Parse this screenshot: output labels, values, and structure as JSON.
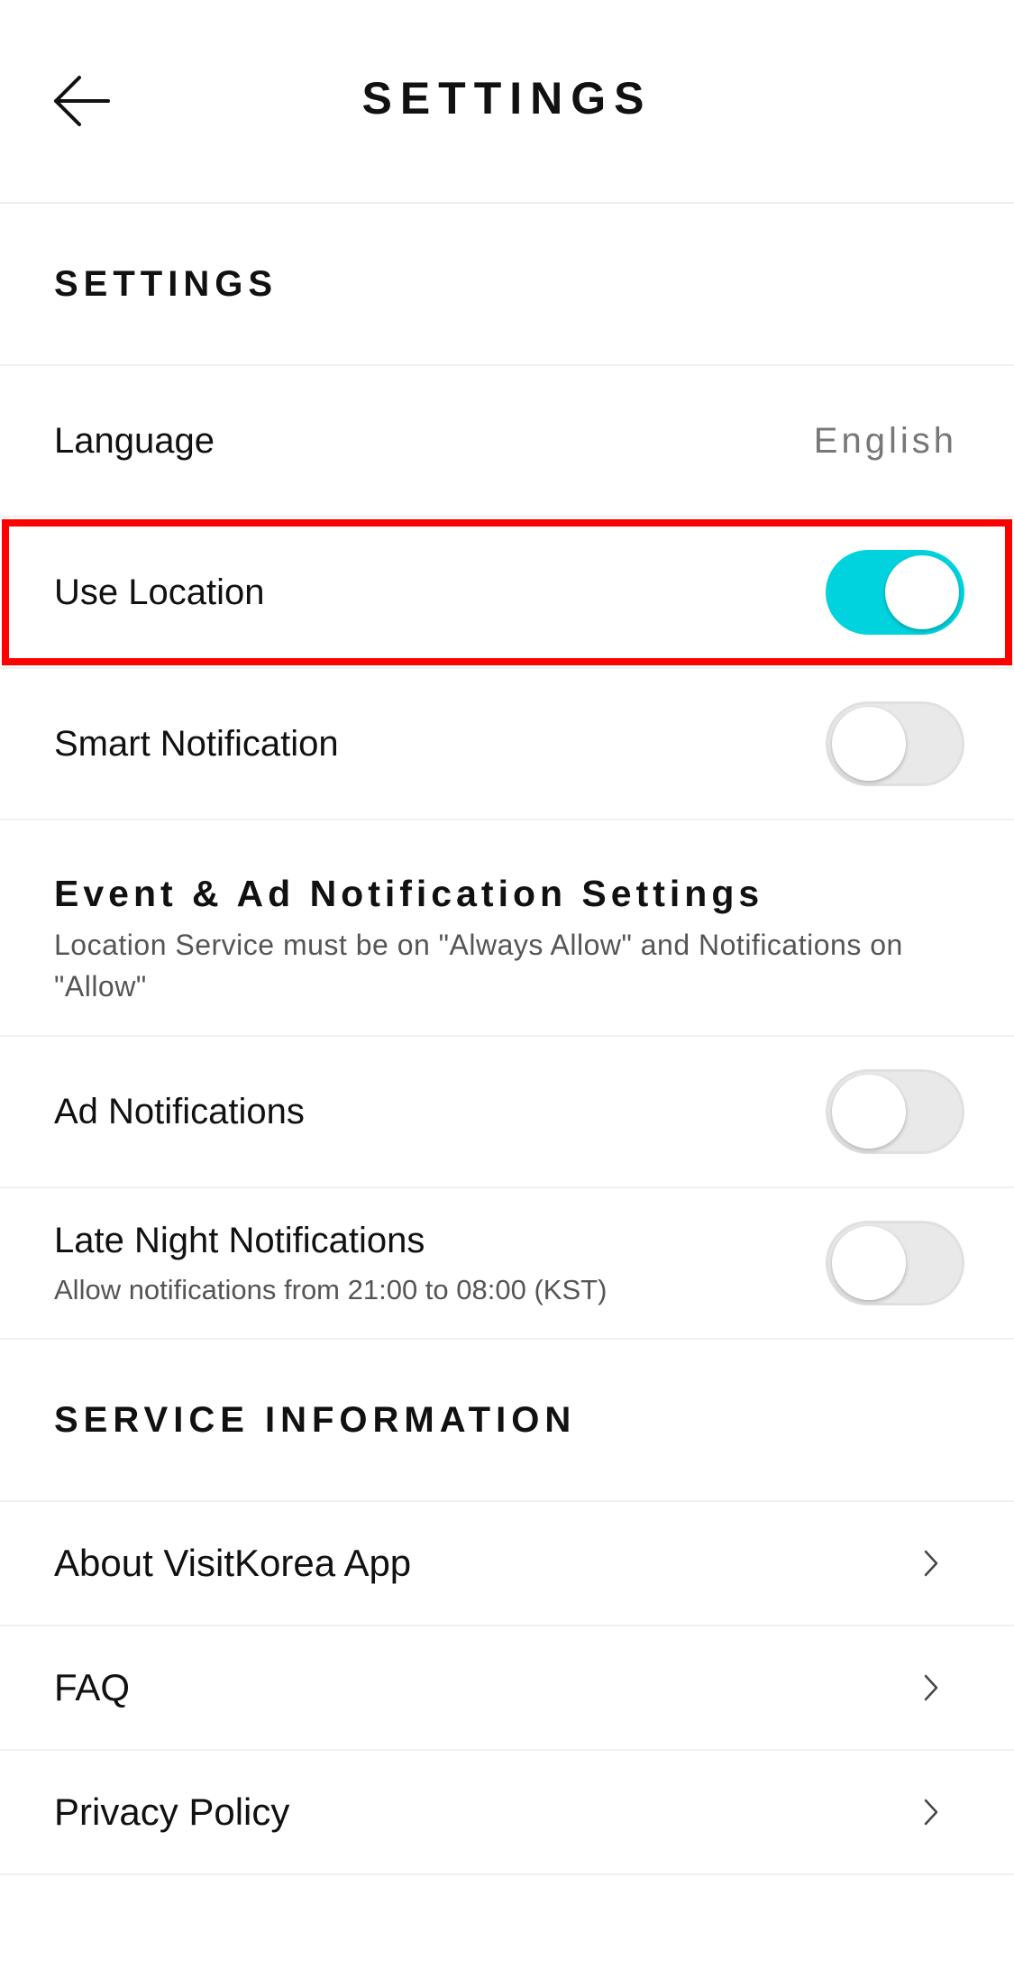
{
  "header": {
    "title": "SETTINGS"
  },
  "settings_section": {
    "title": "SETTINGS",
    "language": {
      "label": "Language",
      "value": "English"
    },
    "use_location": {
      "label": "Use Location",
      "enabled": true
    },
    "smart_notification": {
      "label": "Smart Notification",
      "enabled": false
    }
  },
  "event_section": {
    "title": "Event & Ad Notification Settings",
    "description": "Location Service must be on \"Always Allow\" and Notifications on \"Allow\"",
    "ad_notifications": {
      "label": "Ad Notifications",
      "enabled": false
    },
    "late_night": {
      "label": "Late Night Notifications",
      "sublabel": "Allow notifications from 21:00 to 08:00 (KST)",
      "enabled": false
    }
  },
  "service_section": {
    "title": "SERVICE INFORMATION",
    "items": [
      {
        "label": "About VisitKorea App"
      },
      {
        "label": "FAQ"
      },
      {
        "label": "Privacy Policy"
      }
    ]
  },
  "colors": {
    "toggle_on": "#00d3de",
    "toggle_off": "#e9e9e9",
    "highlight": "#ff0000"
  }
}
